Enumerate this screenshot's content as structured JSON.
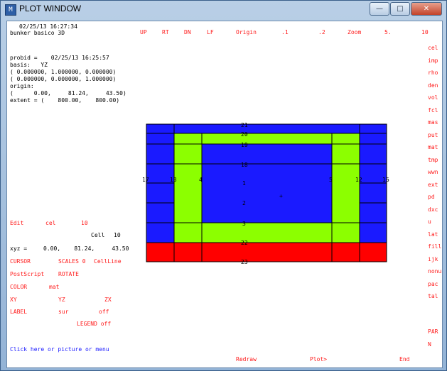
{
  "window": {
    "title": "PLOT WINDOW",
    "controls": [
      "minimize",
      "maximize",
      "close"
    ],
    "colors": {
      "titlebar": "#b9cfe6",
      "close": "#c2432a"
    }
  },
  "header": {
    "date": "02/25/13 16:27:34",
    "subtitle": "bunker basico 3D"
  },
  "top_menu": [
    "UP",
    "RT",
    "DN",
    "LF",
    "Origin",
    ".1",
    ".2",
    "Zoom",
    "5.",
    "10"
  ],
  "info": {
    "probid": "probid =    02/25/13 16:25:57",
    "basis": "basis:   YZ",
    "basis_vec1": "( 0.000000, 1.000000, 0.000000)",
    "basis_vec2": "( 0.000000, 0.000000, 1.000000)",
    "origin_label": "origin:",
    "origin": "(      0.00,     81.24,     43.50)",
    "extent": "extent = (    800.00,    800.00)"
  },
  "right_menu": [
    "cel",
    "imp",
    "rho",
    "den",
    "vol",
    "fcl",
    "mas",
    "put",
    "mat",
    "tmp",
    "wwn",
    "ext",
    "pd",
    "dxc",
    "u",
    "lat",
    "fill",
    "ijk",
    "nonu",
    "pac",
    "tal",
    "PAR",
    "N"
  ],
  "left_controls": {
    "edit": "Edit",
    "edit_mode": "cel",
    "edit_value": "10",
    "cell_label": "Cell",
    "cell_value": "10",
    "xyz_label": "xyz =",
    "xyz_values": "0.00,    81.24,     43.50",
    "cursor": "CURSOR",
    "scales": "SCALES 0",
    "cellline": "CellLine",
    "postscript": "PostScript",
    "rotate": "ROTATE",
    "color": "COLOR",
    "color_mode": "mat",
    "xy": "XY",
    "yz": "YZ",
    "zx": "ZX",
    "label": "LABEL",
    "label_mode": "sur",
    "label_off": "off",
    "legend": "LEGEND off"
  },
  "status": "Click here or picture or menu",
  "bottom_menu": {
    "redraw": "Redraw",
    "plot": "Plot>",
    "end": "End"
  },
  "plot": {
    "colors": {
      "blue": "#1a1aff",
      "green": "#8cff00",
      "red": "#ff0000"
    },
    "surface_labels": [
      "21",
      "20",
      "19",
      "18",
      "1",
      "2",
      "3",
      "4",
      "5",
      "12",
      "13",
      "16",
      "17",
      "22",
      "23",
      "+"
    ]
  }
}
